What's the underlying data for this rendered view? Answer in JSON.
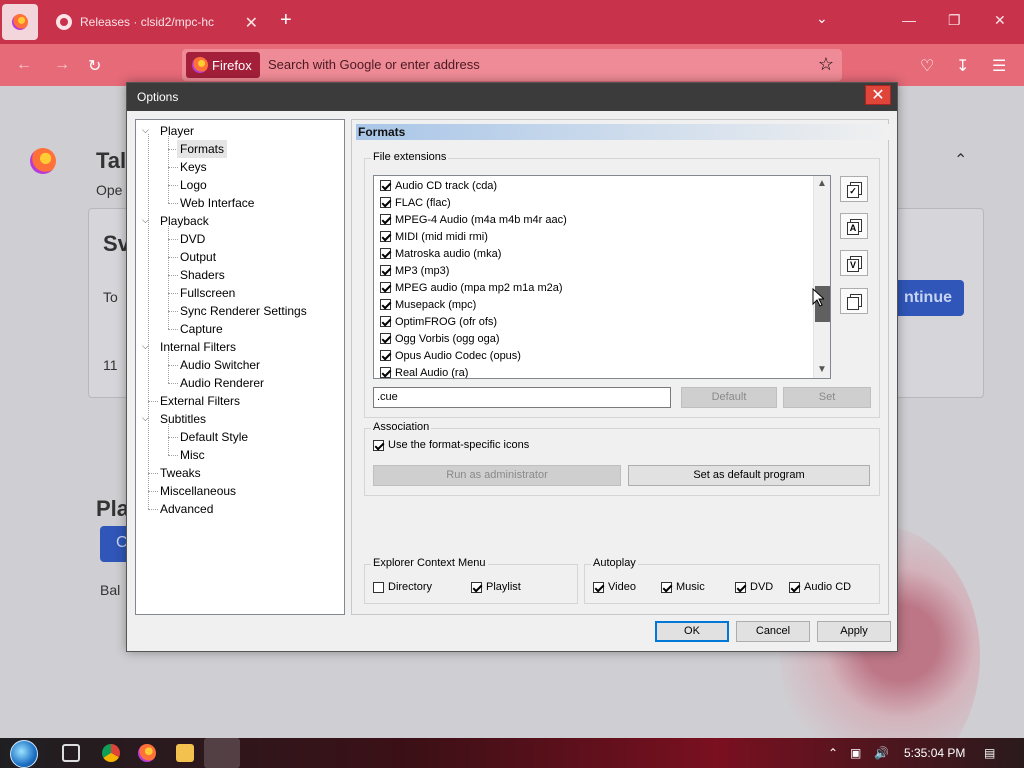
{
  "browser": {
    "tab_title": "Releases · clsid2/mpc-hc",
    "new_tab": "+",
    "tab_close": "✕",
    "url_chip": "Firefox",
    "url_placeholder": "Search with Google or enter address"
  },
  "page_bg": {
    "heading_fragment": "Tal",
    "sub_fragment": "Ope",
    "card_fragment": "Sv",
    "to_fragment": "To",
    "num_fragment": "11",
    "button_fragment": "ntinue",
    "play_heading": "Pla",
    "play_sub": "Bal",
    "button2_fragment": "C"
  },
  "dialog": {
    "title": "Options",
    "close": "✕",
    "tree": [
      {
        "label": "Player",
        "level": 0,
        "expanded": true
      },
      {
        "label": "Formats",
        "level": 1,
        "selected": true
      },
      {
        "label": "Keys",
        "level": 1
      },
      {
        "label": "Logo",
        "level": 1
      },
      {
        "label": "Web Interface",
        "level": 1
      },
      {
        "label": "Playback",
        "level": 0,
        "expanded": true
      },
      {
        "label": "DVD",
        "level": 1
      },
      {
        "label": "Output",
        "level": 1
      },
      {
        "label": "Shaders",
        "level": 1
      },
      {
        "label": "Fullscreen",
        "level": 1
      },
      {
        "label": "Sync Renderer Settings",
        "level": 1
      },
      {
        "label": "Capture",
        "level": 1
      },
      {
        "label": "Internal Filters",
        "level": 0,
        "expanded": true
      },
      {
        "label": "Audio Switcher",
        "level": 1
      },
      {
        "label": "Audio Renderer",
        "level": 1
      },
      {
        "label": "External Filters",
        "level": 0
      },
      {
        "label": "Subtitles",
        "level": 0,
        "expanded": true
      },
      {
        "label": "Default Style",
        "level": 1
      },
      {
        "label": "Misc",
        "level": 1
      },
      {
        "label": "Tweaks",
        "level": 0
      },
      {
        "label": "Miscellaneous",
        "level": 0
      },
      {
        "label": "Advanced",
        "level": 0
      }
    ],
    "section_title": "Formats",
    "file_ext_label": "File extensions",
    "extensions": [
      {
        "label": "Audio CD track (cda)",
        "checked": true
      },
      {
        "label": "FLAC (flac)",
        "checked": true
      },
      {
        "label": "MPEG-4 Audio (m4a m4b m4r aac)",
        "checked": true
      },
      {
        "label": "MIDI (mid midi rmi)",
        "checked": true
      },
      {
        "label": "Matroska audio (mka)",
        "checked": true
      },
      {
        "label": "MP3 (mp3)",
        "checked": true
      },
      {
        "label": "MPEG audio (mpa mp2 m1a m2a)",
        "checked": true
      },
      {
        "label": "Musepack (mpc)",
        "checked": true
      },
      {
        "label": "OptimFROG (ofr ofs)",
        "checked": true
      },
      {
        "label": "Ogg Vorbis (ogg oga)",
        "checked": true
      },
      {
        "label": "Opus Audio Codec (opus)",
        "checked": true
      },
      {
        "label": "Real Audio (ra)",
        "checked": true
      }
    ],
    "side_icons": [
      "select-all-icon",
      "select-audio-icon",
      "select-video-icon",
      "clear-selection-icon"
    ],
    "side_icon_letters": [
      "",
      "A",
      "V",
      ""
    ],
    "ext_input": ".cue",
    "default_btn": "Default",
    "set_btn": "Set",
    "association_label": "Association",
    "use_icons_label": "Use the format-specific icons",
    "use_icons_checked": true,
    "run_admin_btn": "Run as administrator",
    "set_default_btn": "Set as default program",
    "explorer_label": "Explorer Context Menu",
    "directory_label": "Directory",
    "directory_checked": false,
    "playlist_label": "Playlist",
    "playlist_checked": true,
    "autoplay_label": "Autoplay",
    "video_label": "Video",
    "music_label": "Music",
    "dvd_label": "DVD",
    "audiocd_label": "Audio CD",
    "ok_btn": "OK",
    "cancel_btn": "Cancel",
    "apply_btn": "Apply"
  },
  "taskbar": {
    "clock": "5:35:04 PM"
  }
}
